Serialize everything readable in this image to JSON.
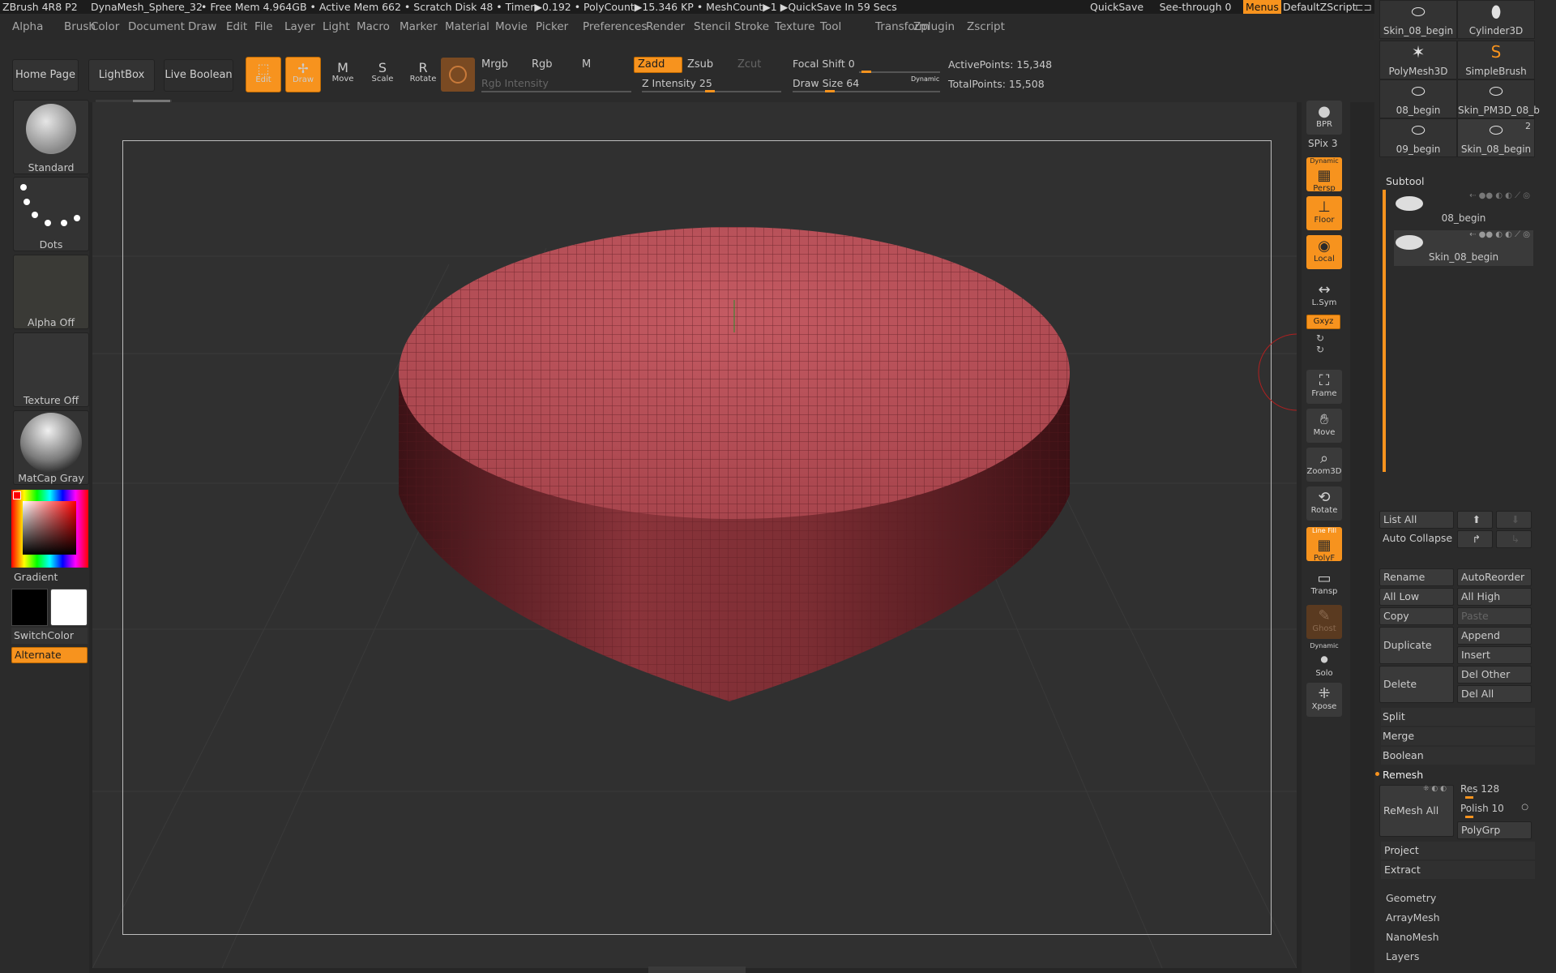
{
  "titlebar": {
    "app": "ZBrush 4R8 P2",
    "doc": "DynaMesh_Sphere_32",
    "mem": "• Free Mem 4.964GB • Active Mem 662 • Scratch Disk 48 • Timer▶0.192 • PolyCount▶15.346 KP • MeshCount▶1 ▶QuickSave In 59 Secs",
    "quicksave": "QuickSave",
    "seethrough": "See-through  0",
    "menus": "Menus",
    "script": "DefaultZScript"
  },
  "menu": [
    "Alpha",
    "Brush",
    "Color",
    "Document",
    "Draw",
    "Edit",
    "File",
    "Layer",
    "Light",
    "Macro",
    "Marker",
    "Material",
    "Movie",
    "Picker",
    "Preferences",
    "Render",
    "Stencil",
    "Stroke",
    "Texture",
    "Tool",
    "Transform",
    "Zplugin",
    "Zscript"
  ],
  "toolbar": {
    "home": "Home Page",
    "lightbox": "LightBox",
    "liveboolean": "Live Boolean",
    "edit": "Edit",
    "draw": "Draw",
    "move": "Move",
    "scale": "Scale",
    "rotate": "Rotate",
    "mrgb": "Mrgb",
    "rgb": "Rgb",
    "m": "M",
    "zadd": "Zadd",
    "zsub": "Zsub",
    "zcut": "Zcut",
    "rgb_intensity": "Rgb Intensity",
    "z_intensity": "Z Intensity 25",
    "focal_shift": "Focal Shift 0",
    "draw_size": "Draw Size 64",
    "dynamic": "Dynamic",
    "active_points": "ActivePoints: 15,348",
    "total_points": "TotalPoints: 15,508"
  },
  "left": {
    "brush": "Standard",
    "stroke": "Dots",
    "alpha": "Alpha Off",
    "texture": "Texture Off",
    "material": "MatCap Gray",
    "gradient": "Gradient",
    "switchcolor": "SwitchColor",
    "alternate": "Alternate"
  },
  "right": {
    "bpr": "BPR",
    "spix": "SPix 3",
    "persp": "Persp",
    "floor": "Floor",
    "local": "Local",
    "lsym": "L.Sym",
    "xyz": "Gxyz",
    "frame": "Frame",
    "move": "Move",
    "zoom": "Zoom3D",
    "rotate": "Rotate",
    "polyf": "PolyF",
    "transp": "Transp",
    "ghost": "Ghost",
    "solo": "Solo",
    "xpose": "Xpose",
    "dynamic": "Dynamic",
    "linefill": "Line Fill"
  },
  "tools": [
    {
      "name": "Skin_08_begin"
    },
    {
      "name": "Cylinder3D"
    },
    {
      "name": "PolyMesh3D"
    },
    {
      "name": "SimpleBrush"
    },
    {
      "name": "08_begin"
    },
    {
      "name": "Skin_PM3D_08_b"
    },
    {
      "name": "09_begin"
    },
    {
      "name": "Skin_08_begin",
      "badge": "2"
    }
  ],
  "subtool": {
    "title": "Subtool",
    "items": [
      "08_begin",
      "Skin_08_begin"
    ],
    "list_all": "List All",
    "auto_collapse": "Auto Collapse",
    "rename": "Rename",
    "autoreorder": "AutoReorder",
    "all_low": "All Low",
    "all_high": "All High",
    "copy": "Copy",
    "paste": "Paste",
    "duplicate": "Duplicate",
    "append": "Append",
    "insert": "Insert",
    "delete": "Delete",
    "del_other": "Del Other",
    "del_all": "Del All",
    "split": "Split",
    "merge": "Merge",
    "boolean": "Boolean",
    "remesh": "Remesh",
    "remesh_all": "ReMesh All",
    "res": "Res 128",
    "polish": "Polish 10",
    "polygrp": "PolyGrp",
    "project": "Project",
    "extract": "Extract"
  },
  "sections": [
    "Geometry",
    "ArrayMesh",
    "NanoMesh",
    "Layers"
  ],
  "colors": {
    "accent": "#f7931e",
    "mesh": "#b5494f"
  }
}
